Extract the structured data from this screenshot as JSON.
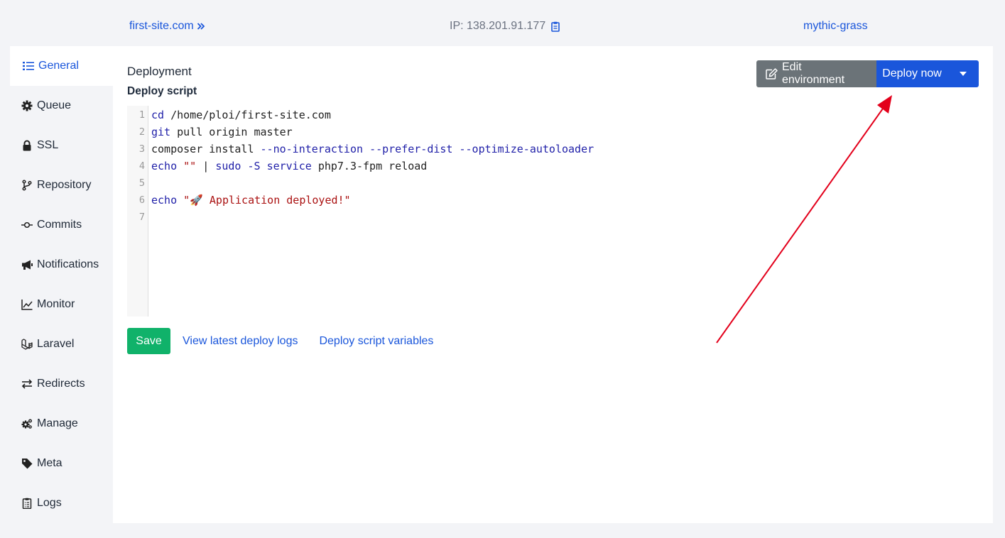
{
  "header": {
    "site_name": "first-site.com",
    "ip_label": "IP: 138.201.91.177",
    "server_name": "mythic-grass"
  },
  "sidebar": {
    "items": [
      {
        "label": "General",
        "icon": "list-icon",
        "active": true
      },
      {
        "label": "Queue",
        "icon": "gear-icon"
      },
      {
        "label": "SSL",
        "icon": "lock-icon"
      },
      {
        "label": "Repository",
        "icon": "code-branch-icon"
      },
      {
        "label": "Commits",
        "icon": "commit-icon"
      },
      {
        "label": "Notifications",
        "icon": "megaphone-icon"
      },
      {
        "label": "Monitor",
        "icon": "line-chart-icon"
      },
      {
        "label": "Laravel",
        "icon": "laravel-icon"
      },
      {
        "label": "Redirects",
        "icon": "exchange-icon"
      },
      {
        "label": "Manage",
        "icon": "cogs-icon"
      },
      {
        "label": "Meta",
        "icon": "tag-icon"
      },
      {
        "label": "Logs",
        "icon": "clipboard-list-icon"
      }
    ]
  },
  "main": {
    "title": "Deployment",
    "subtitle": "Deploy script",
    "buttons": {
      "edit_environment": "Edit environment",
      "deploy_now": "Deploy now"
    },
    "script": {
      "line_numbers": [
        "1",
        "2",
        "3",
        "4",
        "5",
        "6",
        "7"
      ],
      "lines": [
        "cd /home/ploi/first-site.com",
        "git pull origin master",
        "composer install --no-interaction --prefer-dist --optimize-autoloader",
        "echo \"\" | sudo -S service php7.3-fpm reload",
        "",
        "echo \"🚀 Application deployed!\"",
        ""
      ]
    },
    "actions": {
      "save": "Save",
      "view_logs": "View latest deploy logs",
      "script_variables": "Deploy script variables"
    }
  },
  "colors": {
    "accent": "#1a56db",
    "save": "#10b26a",
    "edit_button": "#6b7378",
    "annotation_arrow": "#e3001b"
  }
}
